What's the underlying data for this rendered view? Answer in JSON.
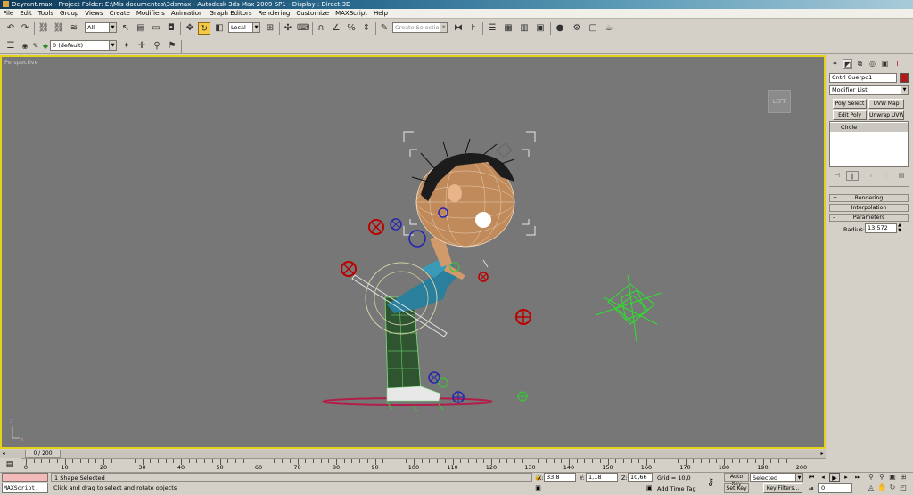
{
  "titlebar": {
    "text": "Deyrant.max    - Project Folder: E:\\Mis documentos\\3dsmax     - Autodesk 3ds Max  2009 SP1        - Display : Direct 3D"
  },
  "menu": [
    "File",
    "Edit",
    "Tools",
    "Group",
    "Views",
    "Create",
    "Modifiers",
    "Animation",
    "Graph Editors",
    "Rendering",
    "Customize",
    "MAXScript",
    "Help"
  ],
  "toolbar": {
    "selection_filter": "All",
    "coord_system": "Local",
    "named_selection_placeholder": "Create Selection Set",
    "layer": "0 (default)"
  },
  "viewport": {
    "label": "Perspective",
    "viewcube": "LEFT"
  },
  "command_panel": {
    "object_name": "Cntrl Cuerpo1",
    "object_color": "#b3181a",
    "modifier_list": "Modifier List",
    "buttons": [
      "Poly Select",
      "UVW Map",
      "Edit Poly",
      "Unwrap UVW"
    ],
    "stack_item": "Circle",
    "rollouts": [
      {
        "sign": "+",
        "label": "Rendering"
      },
      {
        "sign": "+",
        "label": "Interpolation"
      },
      {
        "sign": "-",
        "label": "Parameters"
      }
    ],
    "radius_label": "Radius:",
    "radius_value": "13,572"
  },
  "timeline": {
    "slider": "0 / 200",
    "ticks": [
      "0",
      "10",
      "20",
      "30",
      "40",
      "50",
      "60",
      "70",
      "80",
      "90",
      "100",
      "110",
      "120",
      "130",
      "140",
      "150",
      "160",
      "170",
      "180",
      "190",
      "200"
    ]
  },
  "status": {
    "maxscript": "MAXScript.",
    "selection": "1 Shape Selected",
    "prompt": "Click and drag to select and rotate objects",
    "x_label": "X:",
    "x": "33,8",
    "y_label": "Y:",
    "y": "1,18",
    "z_label": "Z:",
    "z": "10,66",
    "grid": "Grid = 10,0",
    "add_time_tag": "Add Time Tag",
    "auto_key": "Auto Key",
    "set_key": "Set Key",
    "selected": "Selected",
    "key_filters": "Key Filters...",
    "frame": "0"
  }
}
